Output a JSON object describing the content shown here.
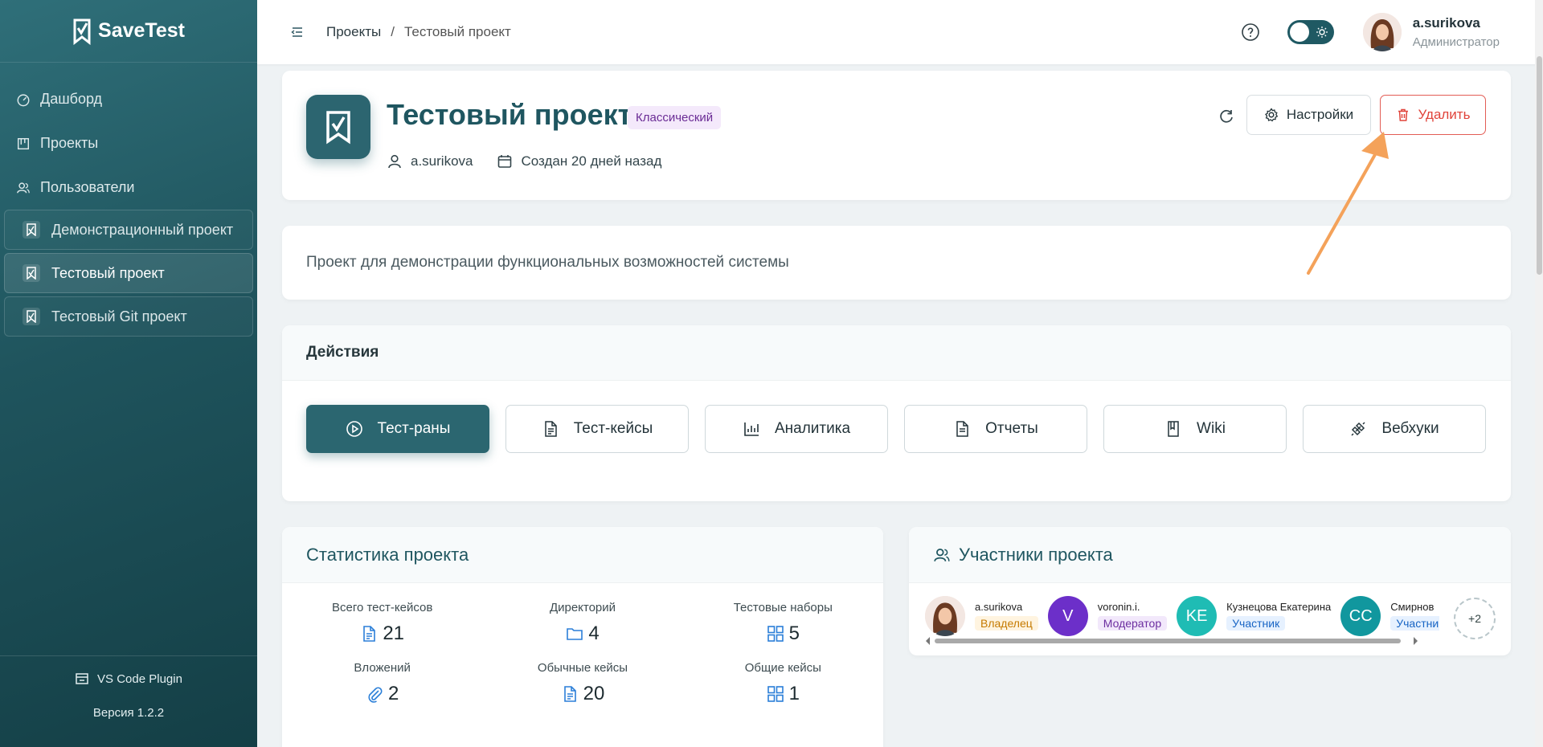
{
  "app": {
    "name": "SaveTest"
  },
  "sidebar": {
    "nav": [
      {
        "label": "Дашборд",
        "icon": "dashboard-icon"
      },
      {
        "label": "Проекты",
        "icon": "projects-icon"
      },
      {
        "label": "Пользователи",
        "icon": "users-icon"
      }
    ],
    "projects": [
      {
        "label": "Демонстрационный проект",
        "active": false
      },
      {
        "label": "Тестовый проект",
        "active": true
      },
      {
        "label": "Тестовый Git проект",
        "active": false
      }
    ],
    "plugin_label": "VS Code Plugin",
    "version": "Версия 1.2.2"
  },
  "header": {
    "breadcrumb": [
      "Проекты",
      "/",
      "Тестовый проект"
    ],
    "user": {
      "name": "a.surikova",
      "role": "Администратор"
    }
  },
  "project": {
    "title": "Тестовый проект",
    "type_badge": "Классический",
    "owner": "a.surikova",
    "created": "Создан 20 дней назад",
    "settings_label": "Настройки",
    "delete_label": "Удалить",
    "description": "Проект для демонстрации функциональных возможностей системы"
  },
  "actions": {
    "title": "Действия",
    "buttons": [
      {
        "label": "Тест-раны",
        "icon": "play-icon",
        "primary": true
      },
      {
        "label": "Тест-кейсы",
        "icon": "document-icon",
        "primary": false
      },
      {
        "label": "Аналитика",
        "icon": "bar-chart-icon",
        "primary": false
      },
      {
        "label": "Отчеты",
        "icon": "report-icon",
        "primary": false
      },
      {
        "label": "Wiki",
        "icon": "book-icon",
        "primary": false
      },
      {
        "label": "Вебхуки",
        "icon": "webhook-icon",
        "primary": false
      }
    ]
  },
  "stats": {
    "title": "Статистика проекта",
    "items": [
      {
        "label": "Всего тест-кейсов",
        "value": "21",
        "icon": "document-icon"
      },
      {
        "label": "Директорий",
        "value": "4",
        "icon": "folder-icon"
      },
      {
        "label": "Тестовые наборы",
        "value": "5",
        "icon": "grid-icon"
      },
      {
        "label": "Вложений",
        "value": "2",
        "icon": "paperclip-icon"
      },
      {
        "label": "Обычные кейсы",
        "value": "20",
        "icon": "document-icon"
      },
      {
        "label": "Общие кейсы",
        "value": "1",
        "icon": "grid-icon"
      }
    ]
  },
  "members": {
    "title": "Участники проекта",
    "list": [
      {
        "name": "a.surikova",
        "role": "Владелец",
        "initials": "",
        "color": "#f3e7e2"
      },
      {
        "name": "voronin.i.",
        "role": "Модератор",
        "initials": "V",
        "color": "#6c2fc9"
      },
      {
        "name": "Кузнецова Екатерина",
        "role": "Участник",
        "initials": "KE",
        "color": "#1fbcb4"
      },
      {
        "name": "Смирнов",
        "role": "Участник",
        "initials": "CC",
        "color": "#11979e"
      }
    ],
    "more": "+2"
  },
  "colors": {
    "primary": "#2b6670",
    "danger": "#e0433a",
    "accent": "#f4a25a"
  }
}
